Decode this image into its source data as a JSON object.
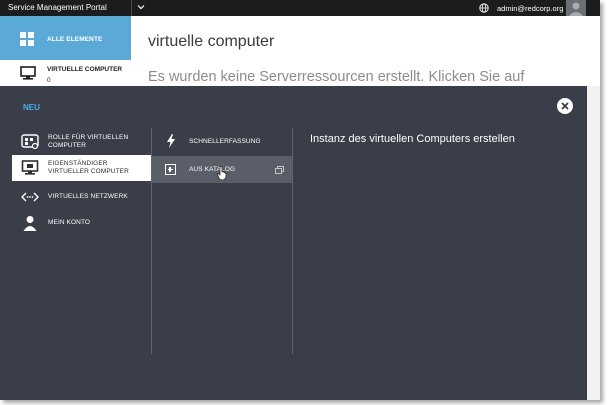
{
  "topbar": {
    "title": "Service Management Portal",
    "user": "admin@redcorp.org"
  },
  "nav": {
    "all_label": "ALLE ELEMENTE",
    "vm_label": "VIRTUELLE COMPUTER",
    "vm_count": "0"
  },
  "main": {
    "title": "virtuelle computer",
    "empty_message": "Es wurden keine Serverressourcen erstellt. Klicken Sie auf"
  },
  "overlay": {
    "title": "NEU",
    "col1": [
      {
        "label": "ROLLE FÜR VIRTUELLEN COMPUTER",
        "icon": "vm-role-icon"
      },
      {
        "label": "EIGENSTÄNDIGER VIRTUELLER COMPUTER",
        "icon": "monitor-icon",
        "selected": true
      },
      {
        "label": "VIRTUELLES NETZWERK",
        "icon": "network-icon"
      },
      {
        "label": "MEIN KONTO",
        "icon": "person-icon"
      }
    ],
    "col2": [
      {
        "label": "SCHNELLERFASSUNG",
        "icon": "lightning-icon"
      },
      {
        "label": "AUS KATALOG",
        "icon": "plus-box-icon",
        "selected": true
      }
    ],
    "col3_text": "Instanz des virtuellen Computers erstellen"
  },
  "colors": {
    "accent": "#5aa9d6",
    "neu_title": "#4aaef0",
    "overlay_bg": "#3a3e48",
    "topbar_bg": "#1c1c1c"
  }
}
